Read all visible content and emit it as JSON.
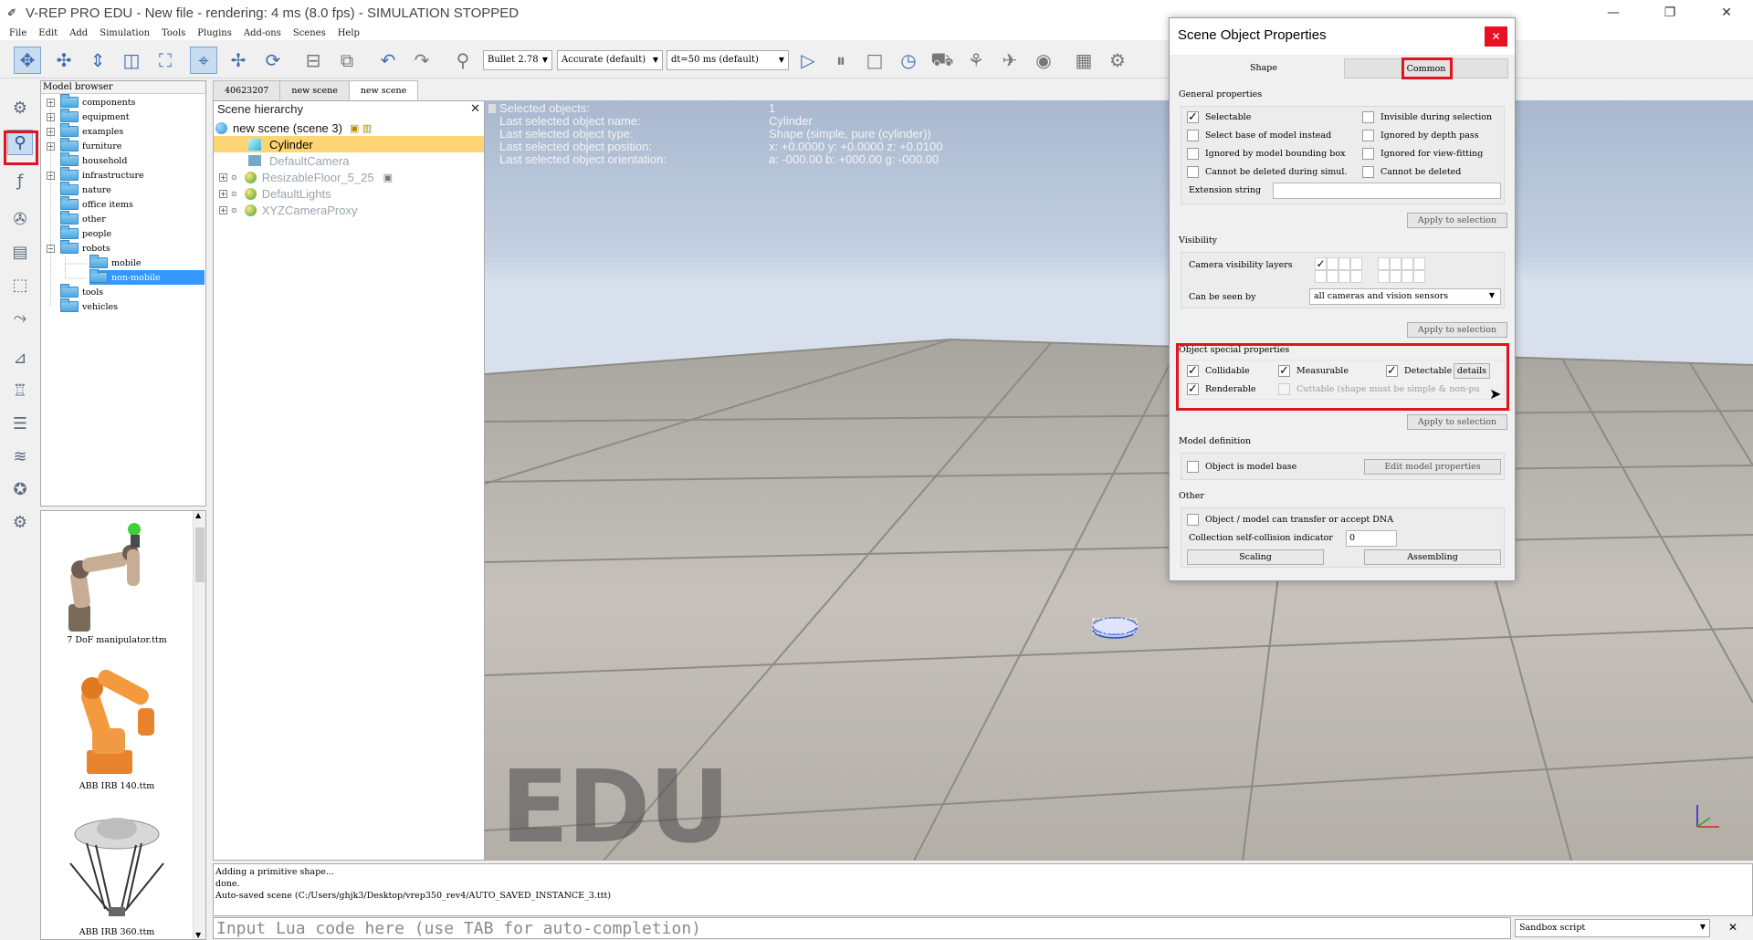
{
  "window": {
    "title": "V-REP PRO EDU - New file - rendering: 4 ms (8.0 fps) - SIMULATION STOPPED",
    "minimize": "—",
    "maximize": "❐",
    "close": "✕"
  },
  "menu": [
    "File",
    "Edit",
    "Add",
    "Simulation",
    "Tools",
    "Plugins",
    "Add-ons",
    "Scenes",
    "Help"
  ],
  "toolbar": {
    "engine": "Bullet 2.78",
    "accuracy": "Accurate (default)",
    "timestep": "dt=50 ms (default)"
  },
  "model_browser": {
    "header": "Model browser",
    "items": [
      {
        "label": "components",
        "expander": "+"
      },
      {
        "label": "equipment",
        "expander": "+"
      },
      {
        "label": "examples",
        "expander": "+"
      },
      {
        "label": "furniture",
        "expander": "+"
      },
      {
        "label": "household",
        "expander": ""
      },
      {
        "label": "infrastructure",
        "expander": "+"
      },
      {
        "label": "nature",
        "expander": ""
      },
      {
        "label": "office items",
        "expander": ""
      },
      {
        "label": "other",
        "expander": ""
      },
      {
        "label": "people",
        "expander": ""
      },
      {
        "label": "robots",
        "expander": "−"
      },
      {
        "label": "mobile",
        "expander": ""
      },
      {
        "label": "non-mobile",
        "expander": ""
      },
      {
        "label": "tools",
        "expander": ""
      },
      {
        "label": "vehicles",
        "expander": ""
      }
    ],
    "thumbnails": [
      "7 DoF manipulator.ttm",
      "ABB IRB 140.ttm",
      "ABB IRB 360.ttm"
    ]
  },
  "scene_tabs": [
    "40623207",
    "new scene",
    "new scene"
  ],
  "hierarchy": {
    "header": "Scene hierarchy",
    "close": "✕",
    "items": [
      {
        "label": "new scene (scene 3)"
      },
      {
        "label": "Cylinder"
      },
      {
        "label": "DefaultCamera"
      },
      {
        "label": "ResizableFloor_5_25"
      },
      {
        "label": "DefaultLights"
      },
      {
        "label": "XYZCameraProxy"
      }
    ]
  },
  "info": {
    "rows": [
      {
        "k": "Selected objects:",
        "v": "1"
      },
      {
        "k": "Last selected object name:",
        "v": "Cylinder"
      },
      {
        "k": "Last selected object type:",
        "v": "Shape (simple, pure (cylinder))"
      },
      {
        "k": "Last selected object position:",
        "v": "x: +0.0000    y: +0.0000    z: +0.0100"
      },
      {
        "k": "Last selected object orientation:",
        "v": "a: -000.00    b: +000.00    g: -000.00"
      }
    ]
  },
  "watermark": "EDU",
  "console": [
    "Adding a primitive shape...",
    "done.",
    "Auto-saved scene (C:/Users/ghjk3/Desktop/vrep350_rev4/AUTO_SAVED_INSTANCE_3.ttt)"
  ],
  "lua": {
    "placeholder": "Input Lua code here (use TAB for auto-completion)",
    "script_select": "Sandbox script",
    "close": "✕"
  },
  "dialog": {
    "title": "Scene Object Properties",
    "close": "✕",
    "tab_shape": "Shape",
    "tab_common": "Common",
    "general": {
      "label": "General properties",
      "selectable": "Selectable",
      "invisible": "Invisible during selection",
      "select_base": "Select base of model instead",
      "ignored_depth": "Ignored by depth pass",
      "ignored_bbox": "Ignored by model bounding  box",
      "ignored_view": "Ignored for view-fitting",
      "no_delete_sim": "Cannot be deleted during simul.",
      "no_delete": "Cannot be deleted",
      "extension": "Extension string",
      "apply": "Apply to selection"
    },
    "visibility": {
      "label": "Visibility",
      "layers": "Camera visibility layers",
      "seen_by": "Can be seen by",
      "seen_by_value": "all cameras and vision sensors",
      "apply": "Apply to selection"
    },
    "special": {
      "label": "Object special properties",
      "collidable": "Collidable",
      "measurable": "Measurable",
      "detectable": "Detectable",
      "details": "details",
      "renderable": "Renderable",
      "cuttable": "Cuttable (shape must be simple & non-pu",
      "apply": "Apply to selection"
    },
    "model": {
      "label": "Model definition",
      "is_base": "Object is model base",
      "edit": "Edit model properties"
    },
    "other": {
      "label": "Other",
      "dna": "Object / model can transfer or accept DNA",
      "collision": "Collection self-collision indicator",
      "collision_value": "0",
      "scaling": "Scaling",
      "assembling": "Assembling"
    }
  },
  "colors": {
    "highlight_red": "#e0141e",
    "selection_yellow": "#fdd574",
    "tree_selection": "#3399ff"
  }
}
